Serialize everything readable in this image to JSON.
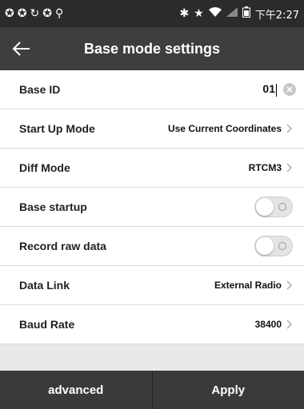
{
  "status_bar": {
    "time": "下午2:27",
    "left_icons": [
      "notification-icon",
      "notification-icon",
      "sync-icon",
      "notification-icon",
      "location-pin-icon"
    ],
    "right_icons": [
      "bluetooth-icon",
      "star-icon",
      "wifi-icon",
      "signal-icon",
      "battery-icon"
    ]
  },
  "header": {
    "title": "Base mode settings",
    "back_icon": "arrow-left-icon"
  },
  "settings": {
    "base_id": {
      "label": "Base ID",
      "value": "01"
    },
    "start_up_mode": {
      "label": "Start Up Mode",
      "value": "Use Current Coordinates"
    },
    "diff_mode": {
      "label": "Diff Mode",
      "value": "RTCM3"
    },
    "base_startup": {
      "label": "Base startup",
      "enabled": false
    },
    "record_raw_data": {
      "label": "Record raw data",
      "enabled": false
    },
    "data_link": {
      "label": "Data Link",
      "value": "External Radio"
    },
    "baud_rate": {
      "label": "Baud Rate",
      "value": "38400"
    }
  },
  "footer": {
    "advanced_label": "advanced",
    "apply_label": "Apply"
  },
  "colors": {
    "status_bar": "#2b2b2b",
    "title_bar": "#3e3e3e",
    "footer": "#3a3a3a",
    "list_background": "#ffffff",
    "page_background": "#e9e9e9"
  }
}
